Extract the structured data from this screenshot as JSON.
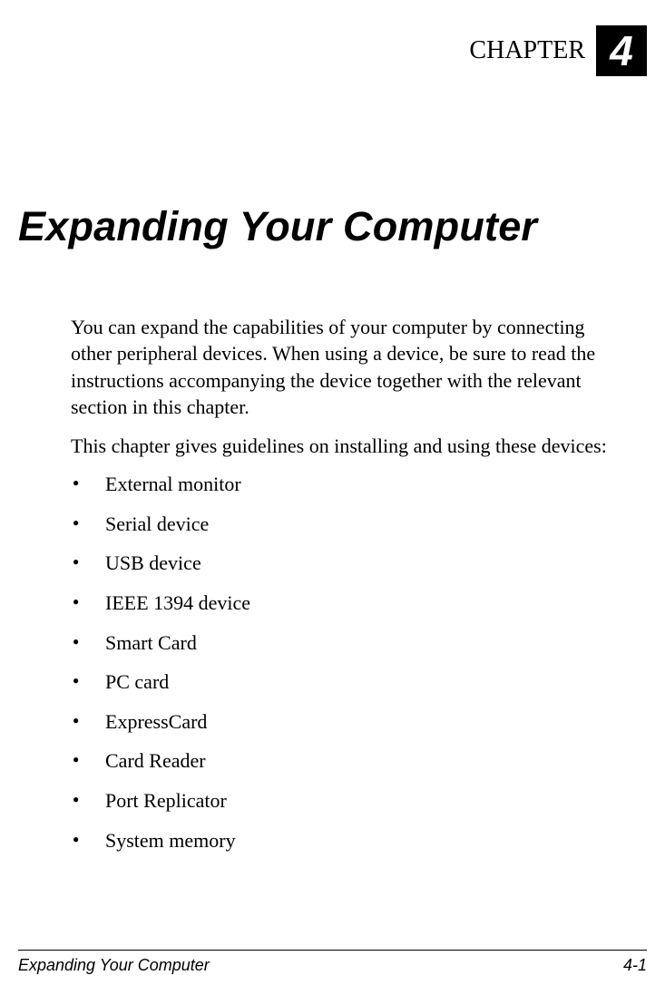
{
  "header": {
    "chapter_label": "CHAPTER",
    "chapter_number": "4"
  },
  "title": "Expanding Your Computer",
  "paragraphs": {
    "p1": "You can expand the capabilities of your computer by connecting other peripheral devices. When using a device, be sure to read the instructions accompanying the device together with the relevant section in this chapter.",
    "p2": "This chapter gives guidelines on installing and using these devices:"
  },
  "bullets": {
    "b0": "External monitor",
    "b1": "Serial device",
    "b2": "USB device",
    "b3": "IEEE 1394 device",
    "b4": "Smart Card",
    "b5": "PC card",
    "b6": "ExpressCard",
    "b7": "Card Reader",
    "b8": "Port Replicator",
    "b9": "System memory"
  },
  "footer": {
    "left": "Expanding Your Computer",
    "right": "4-1"
  }
}
